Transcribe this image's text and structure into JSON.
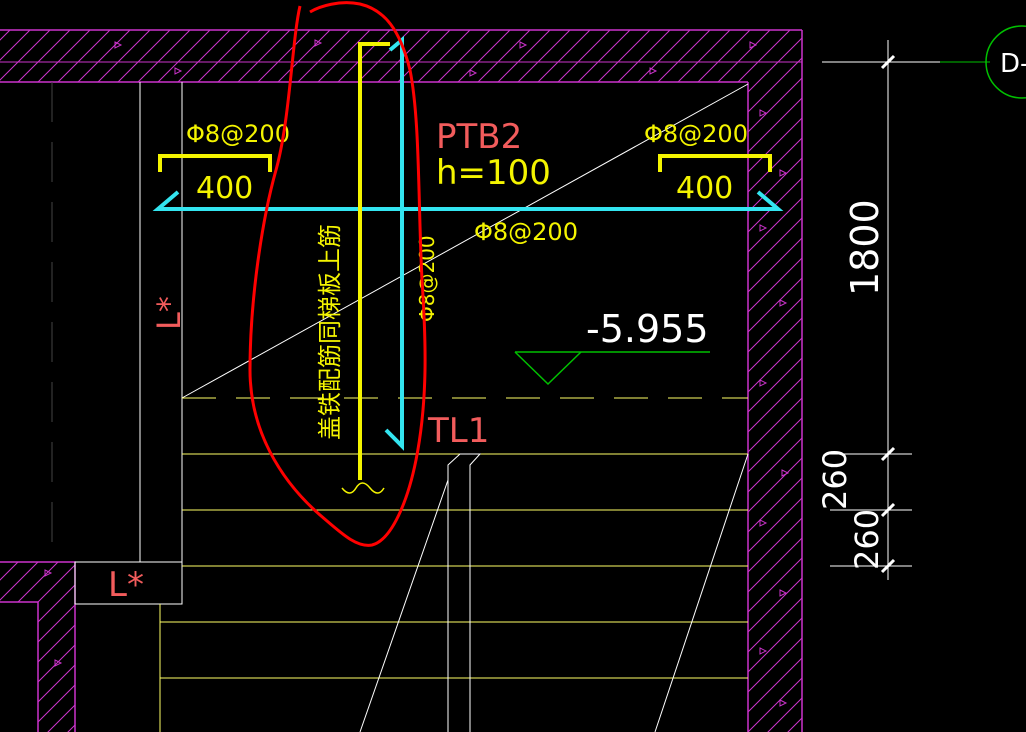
{
  "drawing": {
    "slab_label": "PTB2",
    "thickness_label": "h=100",
    "top_bar_left_label": "Φ8@200",
    "top_bar_right_label": "Φ8@200",
    "distribution_bar_label": "Φ8@200",
    "vertical_bar_label": "Φ8@200",
    "left_hook_length": "400",
    "right_hook_length": "400",
    "elevation_label": "-5.955",
    "beam_label": "TL1",
    "left_wall_label": "L*",
    "bottom_left_label": "L*",
    "annotation_note": "盖铁配筋同梯板上筋",
    "dim_1800": "1800",
    "dim_260_a": "260",
    "dim_260_b": "260",
    "axis_bubble": "D-"
  },
  "colors": {
    "background": "#000000",
    "wall_hatch": "#cc33cc",
    "rebar_cyan": "#33e5f0",
    "rebar_yellow": "#f4f400",
    "label_text": "#f25c5c",
    "markup_red": "#ff0000",
    "stair_lines": "#ffff66",
    "dimension_lines": "#ffffff",
    "elevation_marker": "#00c000"
  }
}
